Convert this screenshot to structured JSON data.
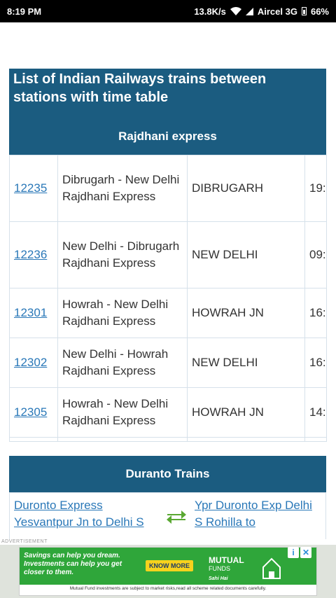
{
  "status_bar": {
    "time": "8:19 PM",
    "speed": "13.8K/s",
    "carrier": "Aircel 3G",
    "battery": "66%"
  },
  "page_title": "List of Indian Railways trains between stations with time table",
  "rajdhani": {
    "title": "Rajdhani express",
    "rows": [
      {
        "number": "12235",
        "name": "Dibrugarh - New Delhi Rajdhani Express",
        "from": "DIBRUGARH",
        "time": "19:"
      },
      {
        "number": "12236",
        "name": "New Delhi - Dibrugarh Rajdhani Express",
        "from": "NEW DELHI",
        "time": "09:"
      },
      {
        "number": "12301",
        "name": "Howrah - New Delhi Rajdhani Express",
        "from": "HOWRAH JN",
        "time": "16:"
      },
      {
        "number": "12302",
        "name": "New Delhi - Howrah Rajdhani Express",
        "from": "NEW DELHI",
        "time": "16:"
      },
      {
        "number": "12305",
        "name": "Howrah - New Delhi Rajdhani Express",
        "from": "HOWRAH JN",
        "time": "14:"
      }
    ]
  },
  "duranto": {
    "title": "Duranto Trains",
    "left_link": "Duronto Express Yesvantpur Jn to Delhi S",
    "right_link": "Ypr Duronto Exp Delhi S Rohilla to"
  },
  "ad": {
    "label": "ADVERTISEMENT",
    "text": "Savings can help you dream. Investments can help you get closer to them.",
    "button": "KNOW MORE",
    "brand_line1": "MUTUAL",
    "brand_line2": "FUNDS",
    "brand_tag": "Sahi Hai",
    "disclaimer": "Mutual Fund investments are subject to market risks,read all scheme related documents carefully.",
    "info_icon": "i",
    "close_icon": "✕"
  },
  "colors": {
    "header_bg": "#1b5c80",
    "link": "#2a78b8",
    "swap_arrows": "#5aa832"
  }
}
